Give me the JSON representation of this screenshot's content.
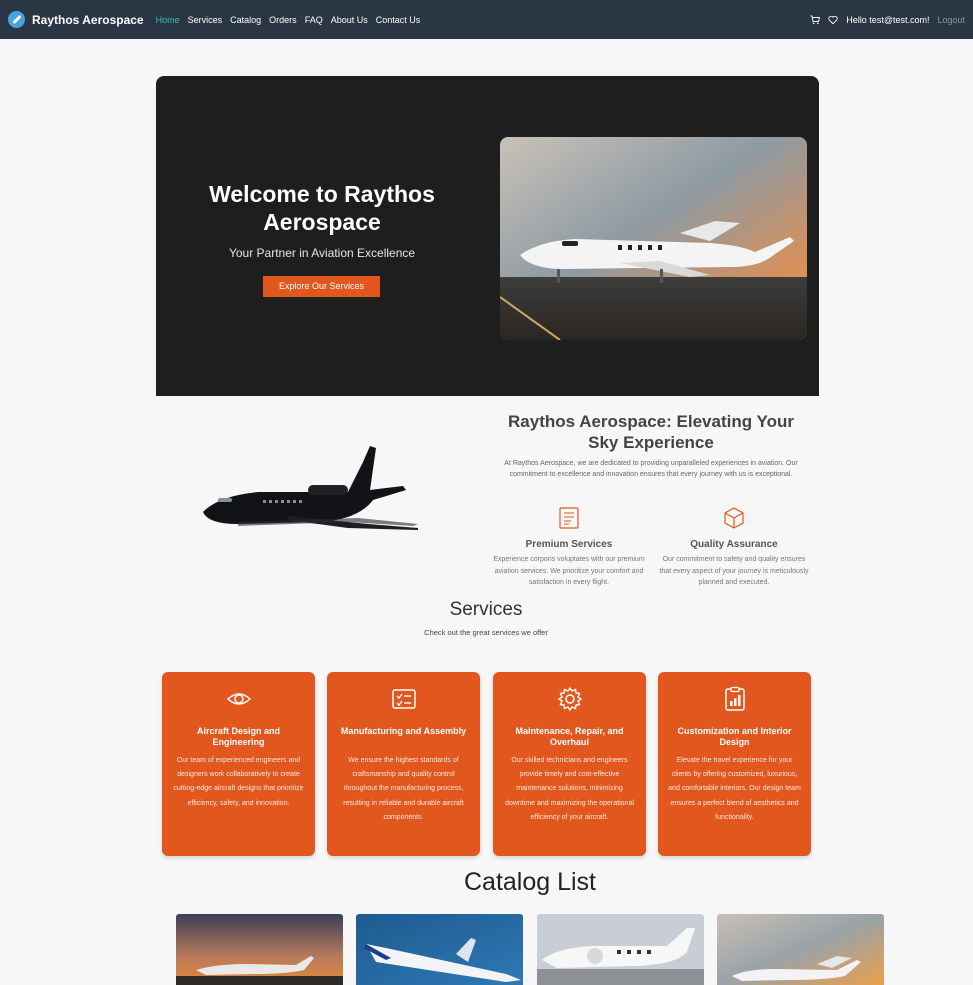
{
  "nav": {
    "brand": "Raythos Aerospace",
    "links": [
      "Home",
      "Services",
      "Catalog",
      "Orders",
      "FAQ",
      "About Us",
      "Contact Us"
    ],
    "greeting": "Hello test@test.com!",
    "logout": "Logout",
    "active_color": "#2fc2b5"
  },
  "hero": {
    "title": "Welcome to Raythos Aerospace",
    "subtitle": "Your Partner in Aviation Excellence",
    "button": "Explore Our Services",
    "accent": "#e2571e"
  },
  "about": {
    "title": "Raythos Aerospace: Elevating Your Sky Experience",
    "text": "At Raythos Aerospace, we are dedicated to providing unparalleled experiences in aviation. Our commitment to excellence and innovation ensures that every journey with us is exceptional.",
    "features": [
      {
        "icon": "certificate-icon",
        "title": "Premium Services",
        "text": "Experience corporis voluptates with our premium aviation services. We prioritize your comfort and satisfaction in every flight."
      },
      {
        "icon": "box-icon",
        "title": "Quality Assurance",
        "text": "Our commitment to safety and quality ensures that every aspect of your journey is meticulously planned and executed."
      }
    ]
  },
  "services": {
    "heading": "Services",
    "subheading": "Check out the great services we offer",
    "cards": [
      {
        "icon": "eye-icon",
        "title": "Aircraft Design and Engineering",
        "text": "Our team of experienced engineers and designers work collaboratively to create cutting-edge aircraft designs that prioritize efficiency, safety, and innovation."
      },
      {
        "icon": "checklist-icon",
        "title": "Manufacturing and Assembly",
        "text": "We ensure the highest standards of craftsmanship and quality control throughout the manufacturing process, resulting in reliable and durable aircraft components."
      },
      {
        "icon": "gear-icon",
        "title": "Maintenance, Repair, and Overhaul",
        "text": "Our skilled technicians and engineers provide timely and cost-effective maintenance solutions, minimizing downtime and maximizing the operational efficiency of your aircraft."
      },
      {
        "icon": "clipboard-chart-icon",
        "title": "Customization and Interior Design",
        "text": "Elevate the travel experience for your clients by offering customized, luxurious, and comfortable interiors. Our design team ensures a perfect blend of aesthetics and functionality."
      }
    ]
  },
  "catalog": {
    "heading": "Catalog List"
  }
}
